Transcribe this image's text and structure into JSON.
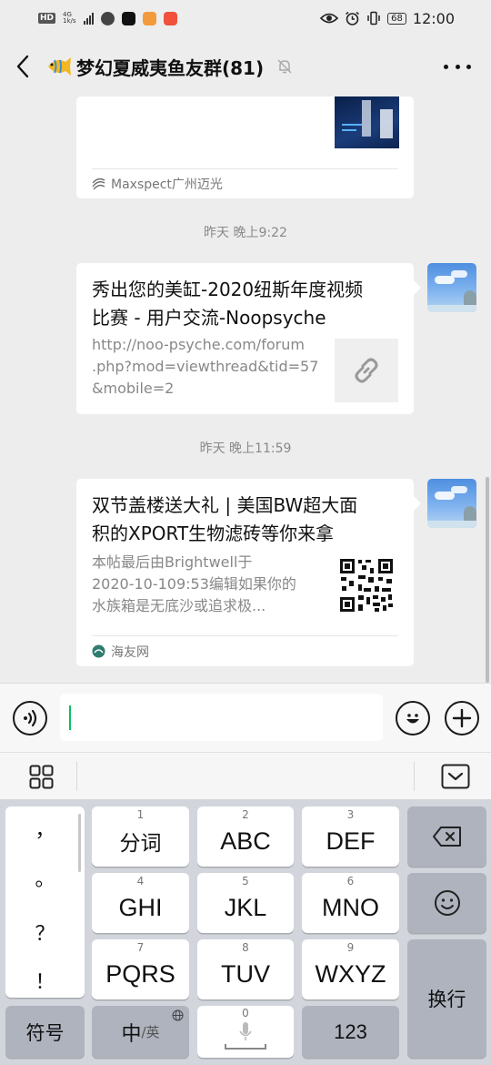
{
  "status_bar": {
    "hd": "HD",
    "network": "4G",
    "network_speed": "1k/s",
    "battery": "68",
    "time": "12:00"
  },
  "nav": {
    "title": "梦幻夏威夷鱼友群(81)"
  },
  "chat": {
    "messages": [
      {
        "source": "Maxspect广州迈光"
      },
      {
        "timestamp": "昨天 晚上9:22",
        "title": "秀出您的美缸-2020纽斯年度视频比赛 - 用户交流-Noopsyche",
        "title_lines": [
          "秀出您的美缸-2020纽斯年度视频",
          "比赛 - 用户交流-Noopsyche"
        ],
        "desc_lines": [
          "http://noo-psyche.com/forum",
          ".php?mod=viewthread&tid=57",
          "&mobile=2"
        ]
      },
      {
        "timestamp": "昨天 晚上11:59",
        "title_lines": [
          "双节盖楼送大礼 | 美国BW超大面",
          "积的XPORT生物滤砖等你来拿"
        ],
        "desc_lines": [
          "本帖最后由Brightwell于",
          "2020-10-109:53编辑如果你的",
          "水族箱是无底沙或追求极..."
        ],
        "source": "海友网"
      }
    ]
  },
  "keyboard": {
    "punctuation": [
      "，",
      "。",
      "？",
      "！"
    ],
    "keys": [
      {
        "num": "1",
        "label": "分词"
      },
      {
        "num": "2",
        "label": "ABC"
      },
      {
        "num": "3",
        "label": "DEF"
      },
      {
        "num": "4",
        "label": "GHI"
      },
      {
        "num": "5",
        "label": "JKL"
      },
      {
        "num": "6",
        "label": "MNO"
      },
      {
        "num": "7",
        "label": "PQRS"
      },
      {
        "num": "8",
        "label": "TUV"
      },
      {
        "num": "9",
        "label": "WXYZ"
      }
    ],
    "symbols_label": "符号",
    "lang_main": "中",
    "lang_alt": "/英",
    "space_num": "0",
    "numbers_label": "123",
    "enter_label": "换行"
  },
  "colors": {
    "caret": "#07c160",
    "chat_bg": "#ededed",
    "keyboard_bg": "#d2d5db"
  }
}
